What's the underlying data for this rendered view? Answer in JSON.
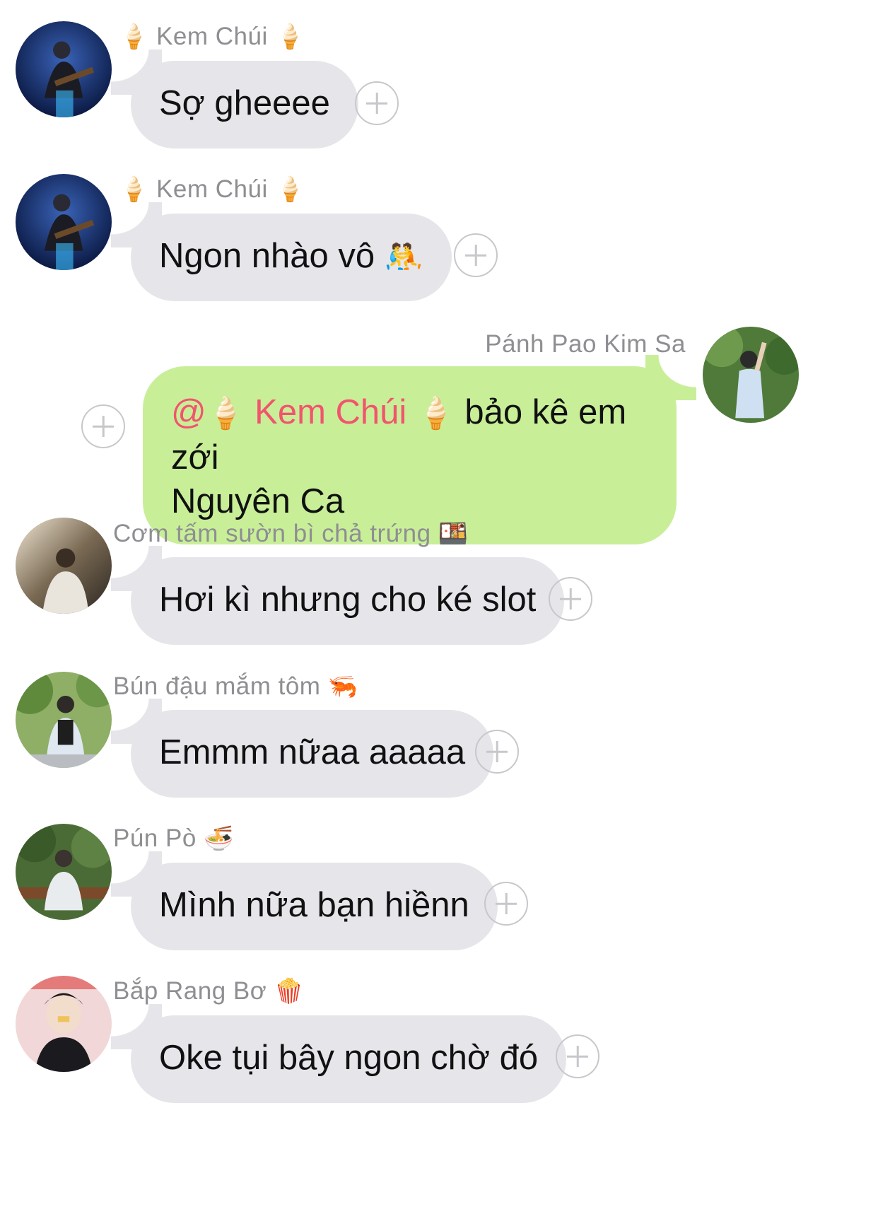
{
  "messages": [
    {
      "sender": "Kem Chúi",
      "sender_prefix_emoji": "🍦",
      "sender_suffix_emoji": "🍦",
      "text": "Sợ gheeee",
      "avatar": "avatar-guitar-performer"
    },
    {
      "sender": "Kem Chúi",
      "sender_prefix_emoji": "🍦",
      "sender_suffix_emoji": "🍦",
      "text": "Ngon nhào vô",
      "text_emoji": "🤼",
      "avatar": "avatar-guitar-performer"
    },
    {
      "sender": "Pánh Pao Kim Sa",
      "mention_at": "@",
      "mention_emoji": "🍦",
      "mention_name": "Kem Chúi",
      "mention_emoji_after": "🍦",
      "text_line1": "bảo kê em zới",
      "text_line2": "Nguyên Ca",
      "avatar": "avatar-man-in-garden"
    },
    {
      "sender": "Cơm tấm sườn bì chả trứng",
      "sender_suffix_emoji": "🍱",
      "text": "Hơi kì nhưng cho ké slot",
      "avatar": "avatar-man-by-water"
    },
    {
      "sender": "Bún đậu mắm tôm",
      "sender_suffix_emoji": "🦐",
      "text": "Emmm nữaa aaaaa",
      "avatar": "avatar-boy-in-park"
    },
    {
      "sender": "Pún Pò",
      "sender_suffix_emoji": "🍜",
      "text": "Mình nữa bạn hiềnn",
      "avatar": "avatar-boy-on-bench"
    },
    {
      "sender": "Bắp Rang Bơ",
      "sender_suffix_emoji": "🍿",
      "text": "Oke tụi bây ngon chờ đó",
      "avatar": "avatar-boy-closeup"
    }
  ],
  "colors": {
    "incoming_bubble": "#e5e5ea",
    "outgoing_bubble": "#c8ef98",
    "mention": "#f2546e",
    "sender_name": "#8e8e93",
    "add_reaction_icon": "#c7c7cc"
  }
}
